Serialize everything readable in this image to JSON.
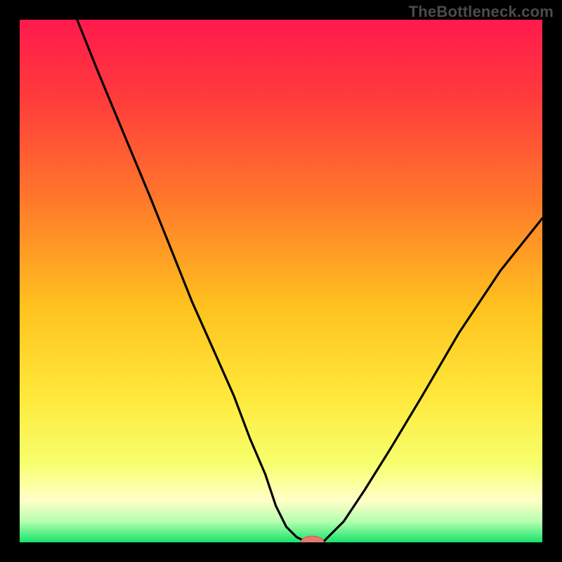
{
  "watermark": "TheBottleneck.com",
  "colors": {
    "page_bg": "#000000",
    "watermark": "#4b4b4b",
    "curve": "#000000",
    "marker_fill": "#e67a6f",
    "marker_stroke": "#c95a50",
    "gradient_stops": [
      {
        "offset": 0.0,
        "color": "#ff1a4d"
      },
      {
        "offset": 0.15,
        "color": "#ff3b3b"
      },
      {
        "offset": 0.35,
        "color": "#ff7a2a"
      },
      {
        "offset": 0.55,
        "color": "#ffc21f"
      },
      {
        "offset": 0.72,
        "color": "#ffe83a"
      },
      {
        "offset": 0.85,
        "color": "#f7ff6e"
      },
      {
        "offset": 0.92,
        "color": "#ffffc8"
      },
      {
        "offset": 0.96,
        "color": "#b6ffb0"
      },
      {
        "offset": 1.0,
        "color": "#17e36a"
      }
    ]
  },
  "chart_data": {
    "type": "line",
    "title": "",
    "xlabel": "",
    "ylabel": "",
    "xlim": [
      0,
      100
    ],
    "ylim": [
      0,
      100
    ],
    "grid": false,
    "legend": false,
    "series": [
      {
        "name": "bottleneck-curve",
        "x": [
          11,
          15,
          20,
          25,
          29,
          33,
          37,
          41,
          44,
          47,
          49,
          51,
          53,
          55,
          58,
          62,
          66,
          71,
          77,
          84,
          92,
          100
        ],
        "values": [
          100,
          90,
          78,
          66,
          56,
          46,
          37,
          28,
          20,
          13,
          7,
          3,
          1,
          0,
          0,
          4,
          10,
          18,
          28,
          40,
          52,
          62
        ]
      }
    ],
    "marker": {
      "x": 56,
      "y": 0,
      "rx": 2.2,
      "ry": 1.2
    }
  }
}
